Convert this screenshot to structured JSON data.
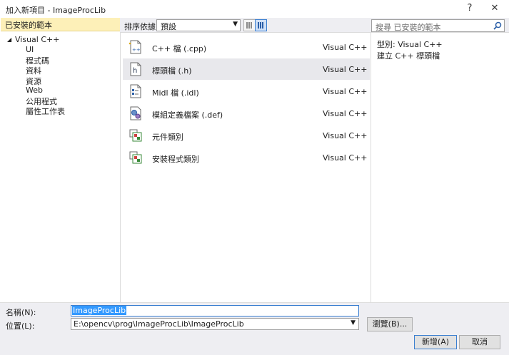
{
  "window": {
    "title": "加入新項目 - ImageProcLib",
    "help_label": "?",
    "close_label": "✕"
  },
  "left_pane": {
    "header": "已安裝的範本",
    "tree_root": "Visual C++",
    "tree_items": [
      "UI",
      "程式碼",
      "資料",
      "資源",
      "Web",
      "公用程式",
      "屬性工作表"
    ]
  },
  "toolbar": {
    "sort_label": "排序依據:",
    "sort_value": "預設",
    "search_placeholder": "搜尋 已安裝的範本"
  },
  "templates": [
    {
      "name": "C++ 檔 (.cpp)",
      "lang": "Visual C++",
      "icon": "cpp-file-icon"
    },
    {
      "name": "標頭檔 (.h)",
      "lang": "Visual C++",
      "icon": "header-file-icon",
      "selected": true
    },
    {
      "name": "Midl 檔 (.idl)",
      "lang": "Visual C++",
      "icon": "midl-file-icon"
    },
    {
      "name": "模組定義檔案 (.def)",
      "lang": "Visual C++",
      "icon": "def-file-icon"
    },
    {
      "name": "元件類別",
      "lang": "Visual C++",
      "icon": "component-class-icon"
    },
    {
      "name": "安裝程式類別",
      "lang": "Visual C++",
      "icon": "installer-class-icon"
    }
  ],
  "details": {
    "type_line": "型別:  Visual C++",
    "description": "建立 C++ 標頭檔"
  },
  "bottom": {
    "name_label": "名稱(N):",
    "name_value": "ImageProcLib",
    "location_label": "位置(L):",
    "location_value": "E:\\opencv\\prog\\ImageProcLib\\ImageProcLib",
    "browse_label": "瀏覽(B)...",
    "add_label": "新增(A)",
    "cancel_label": "取消"
  },
  "colors": {
    "header_bg": "#fdf0b8",
    "selection": "#3399ff",
    "accent_border": "#3b7fd0",
    "chrome_bg": "#eeeef2"
  }
}
